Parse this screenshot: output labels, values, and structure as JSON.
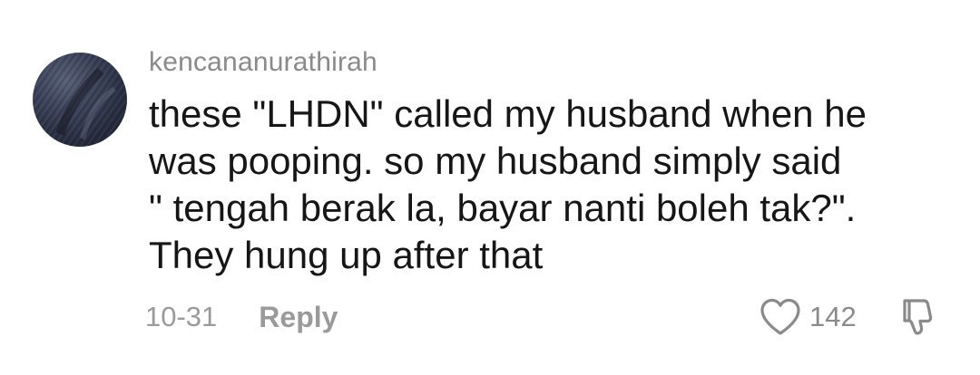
{
  "comment": {
    "username": "kencananurathirah",
    "text_lines": [
      "these \"LHDN\" called my husband when he",
      "was pooping. so my husband simply said",
      "\" tengah berak la, bayar nanti boleh tak?\".",
      "They hung up after that"
    ],
    "date": "10-31",
    "reply_label": "Reply",
    "like_count": "142",
    "icons": {
      "like": "heart-outline-icon",
      "dislike": "thumbs-down-outline-icon"
    },
    "colors": {
      "text": "#161616",
      "muted": "#8a8a8a",
      "background": "#ffffff"
    }
  }
}
